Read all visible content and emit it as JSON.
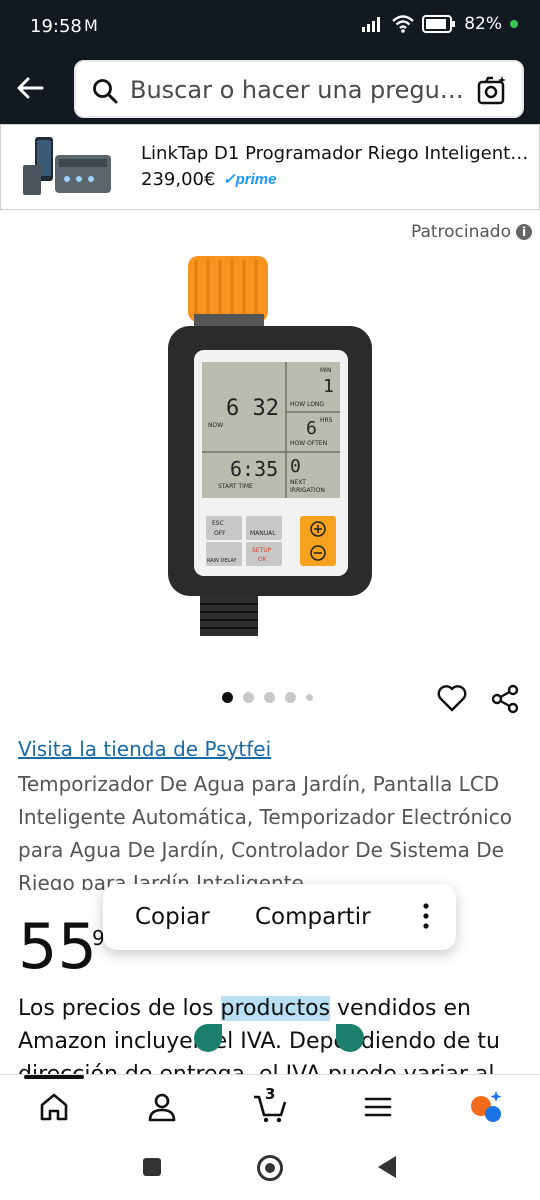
{
  "status": {
    "time": "19:58",
    "mail_icon": "M",
    "battery": "82%"
  },
  "search": {
    "placeholder": "Buscar o hacer una pregu…"
  },
  "sponsored": {
    "title": "LinkTap D1 Programador Riego Inteligente c...",
    "price": "239,00€",
    "prime": "prime",
    "label": "Patrocinado"
  },
  "product": {
    "store_link": "Visita la tienda de Psytfei",
    "title": "Temporizador De Agua para Jardín, Pantalla LCD Inteligente Automática, Temporizador Electrónico para Agua De Jardín, Controlador De Sistema De Riego para Jardín Inteligente",
    "price_whole": "55",
    "price_fraction": "9",
    "image_count": 5,
    "active_image": 1
  },
  "selection_popup": {
    "copy": "Copiar",
    "share": "Compartir"
  },
  "vat": {
    "before": "Los precios de los ",
    "selected": "productos",
    "after": " vendidos en Amazon incluyen el IVA. Dependiendo de tu dirección de entrega, el IVA puede variar al"
  },
  "device_lcd": {
    "min": "MIN",
    "now_time": "6 32",
    "now": "NOW",
    "how_long_value": "1",
    "how_long": "HOW LONG",
    "hrs": "HRS",
    "how_often_value": "6",
    "how_often": "HOW OFTEN",
    "start_time_value": "6:35",
    "start_time": "START TIME",
    "next_value": "0",
    "next_irrigation_1": "NEXT",
    "next_irrigation_2": "IRRIGATION",
    "btn_esc": "ESC",
    "btn_off": "OFF",
    "btn_manual": "MANUAL",
    "btn_rain_delay": "RAIN DELAY",
    "btn_setup": "SETUP",
    "btn_ok": "OK"
  },
  "bottom_nav": {
    "cart_count": "3"
  },
  "colors": {
    "header_bg": "#131921",
    "link": "#1a6aa6",
    "selection": "#b8e0f2",
    "handle": "#1b7f6c",
    "orange": "#f7931e"
  }
}
